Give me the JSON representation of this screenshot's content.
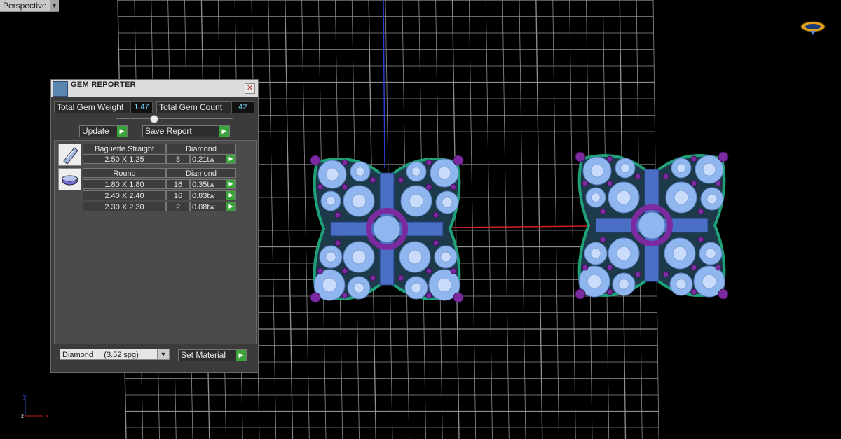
{
  "viewport": {
    "name": "Perspective"
  },
  "gem_reporter": {
    "title": "GEM REPORTER",
    "total_gem_weight_label": "Total Gem Weight",
    "total_gem_weight": "1.47",
    "total_gem_count_label": "Total Gem Count",
    "total_gem_count": "42",
    "update_label": "Update",
    "save_report_label": "Save Report",
    "groups": [
      {
        "shape": "Baguette Straight",
        "material": "Diamond",
        "icon": "baguette-gem-icon",
        "rows": [
          {
            "size": "2.50 X 1.25",
            "count": "8",
            "weight": "0.21tw"
          }
        ]
      },
      {
        "shape": "Round",
        "material": "Diamond",
        "icon": "round-gem-icon",
        "rows": [
          {
            "size": "1.80 X 1.80",
            "count": "16",
            "weight": "0.35tw"
          },
          {
            "size": "2.40 X 2.40",
            "count": "16",
            "weight": "0.83tw"
          },
          {
            "size": "2.30 X 2.30",
            "count": "2",
            "weight": "0.08tw"
          }
        ]
      }
    ],
    "material_select": "Diamond     (3.52 spg)",
    "set_material_label": "Set Material"
  },
  "axis": {
    "y": "y",
    "z": "z",
    "x": "x"
  },
  "colors": {
    "grid": "#8f8f8f",
    "accent_value": "#6fd0f0",
    "go_button": "#3aa33a",
    "gem_blue": "#8fb6ee",
    "prong_purple": "#7b2aa0",
    "metal_outline": "#1fa27a"
  }
}
